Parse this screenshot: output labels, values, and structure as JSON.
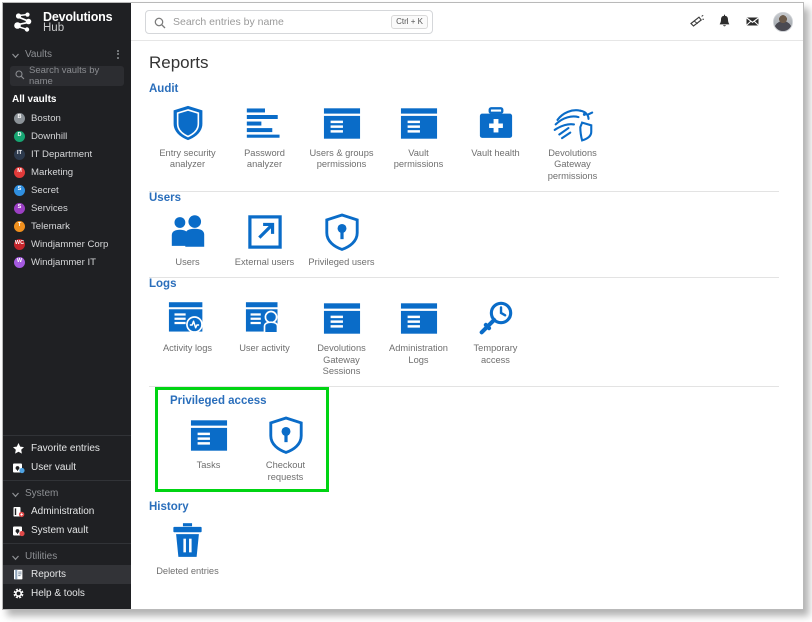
{
  "app": {
    "logo_line1": "Devolutions",
    "logo_line2": "Hub",
    "logo_icon": "devolutions-node-logo"
  },
  "sidebar": {
    "vaults_section": {
      "label": "Vaults",
      "chevron_icon": "chevron-down-icon",
      "menu_icon": "kebab-menu-icon",
      "search_placeholder": "Search vaults by name",
      "search_icon": "search-icon",
      "all_vaults_label": "All vaults"
    },
    "vaults": [
      {
        "name": "Boston",
        "initial": "B",
        "color": "#8b9298"
      },
      {
        "name": "Downhill",
        "initial": "D",
        "color": "#17a673"
      },
      {
        "name": "IT Department",
        "initial": "IT",
        "color": "#2d3a4d"
      },
      {
        "name": "Marketing",
        "initial": "M",
        "color": "#e03a3a"
      },
      {
        "name": "Secret",
        "initial": "S",
        "color": "#2f8fe0"
      },
      {
        "name": "Services",
        "initial": "S",
        "color": "#9c3fc4"
      },
      {
        "name": "Telemark",
        "initial": "T",
        "color": "#f0901e"
      },
      {
        "name": "Windjammer Corp",
        "initial": "WC",
        "color": "#c5252b"
      },
      {
        "name": "Windjammer IT",
        "initial": "W",
        "color": "#a55ae0"
      }
    ],
    "quick_items": [
      {
        "label": "Favorite entries",
        "icon": "star-icon"
      },
      {
        "label": "User vault",
        "icon": "user-vault-icon"
      }
    ],
    "system_section": {
      "label": "System",
      "chevron_icon": "chevron-down-icon",
      "items": [
        {
          "label": "Administration",
          "icon": "administration-icon"
        },
        {
          "label": "System vault",
          "icon": "system-vault-icon"
        }
      ]
    },
    "utilities_section": {
      "label": "Utilities",
      "chevron_icon": "chevron-down-icon",
      "items": [
        {
          "label": "Reports",
          "icon": "reports-icon",
          "active": true
        },
        {
          "label": "Help & tools",
          "icon": "help-tools-icon",
          "active": false
        }
      ]
    }
  },
  "topbar": {
    "search_placeholder": "Search entries by name",
    "search_value": "",
    "search_icon": "search-icon",
    "shortcut_badge": "Ctrl + K",
    "icons": [
      {
        "name": "announcements-icon"
      },
      {
        "name": "notifications-bell-icon"
      },
      {
        "name": "messages-envelope-icon"
      }
    ],
    "avatar_name": "user-avatar"
  },
  "page": {
    "title": "Reports",
    "highlight_color": "#00d413",
    "accent_color": "#0a6cc8",
    "heading_color": "#2a6ebb",
    "groups": [
      {
        "id": "audit",
        "title": "Audit",
        "highlighted": false,
        "tiles": [
          {
            "label": "Entry security\nanalyzer",
            "icon": "shield-icon"
          },
          {
            "label": "Password\nanalyzer",
            "icon": "bar-analysis-icon"
          },
          {
            "label": "Users & groups\npermissions",
            "icon": "window-list-icon"
          },
          {
            "label": "Vault\npermissions",
            "icon": "window-list-icon"
          },
          {
            "label": "Vault health",
            "icon": "medical-kit-icon"
          },
          {
            "label": "Devolutions Gateway\npermissions",
            "icon": "gateway-bird-shield-icon"
          }
        ]
      },
      {
        "id": "users",
        "title": "Users",
        "highlighted": false,
        "tiles": [
          {
            "label": "Users",
            "icon": "two-users-icon"
          },
          {
            "label": "External users",
            "icon": "external-link-icon"
          },
          {
            "label": "Privileged users",
            "icon": "shield-key-icon"
          }
        ]
      },
      {
        "id": "logs",
        "title": "Logs",
        "highlighted": false,
        "tiles": [
          {
            "label": "Activity logs",
            "icon": "window-pulse-icon"
          },
          {
            "label": "User activity",
            "icon": "window-user-icon"
          },
          {
            "label": "Devolutions\nGateway\nSessions",
            "icon": "window-list-icon"
          },
          {
            "label": "Administration\nLogs",
            "icon": "window-list-icon"
          },
          {
            "label": "Temporary\naccess",
            "icon": "key-clock-icon"
          }
        ]
      },
      {
        "id": "privileged-access",
        "title": "Privileged access",
        "highlighted": true,
        "tiles": [
          {
            "label": "Tasks",
            "icon": "window-list-icon"
          },
          {
            "label": "Checkout\nrequests",
            "icon": "shield-key-icon"
          }
        ]
      },
      {
        "id": "history",
        "title": "History",
        "highlighted": false,
        "tiles": [
          {
            "label": "Deleted entries",
            "icon": "trash-icon"
          }
        ]
      }
    ]
  }
}
